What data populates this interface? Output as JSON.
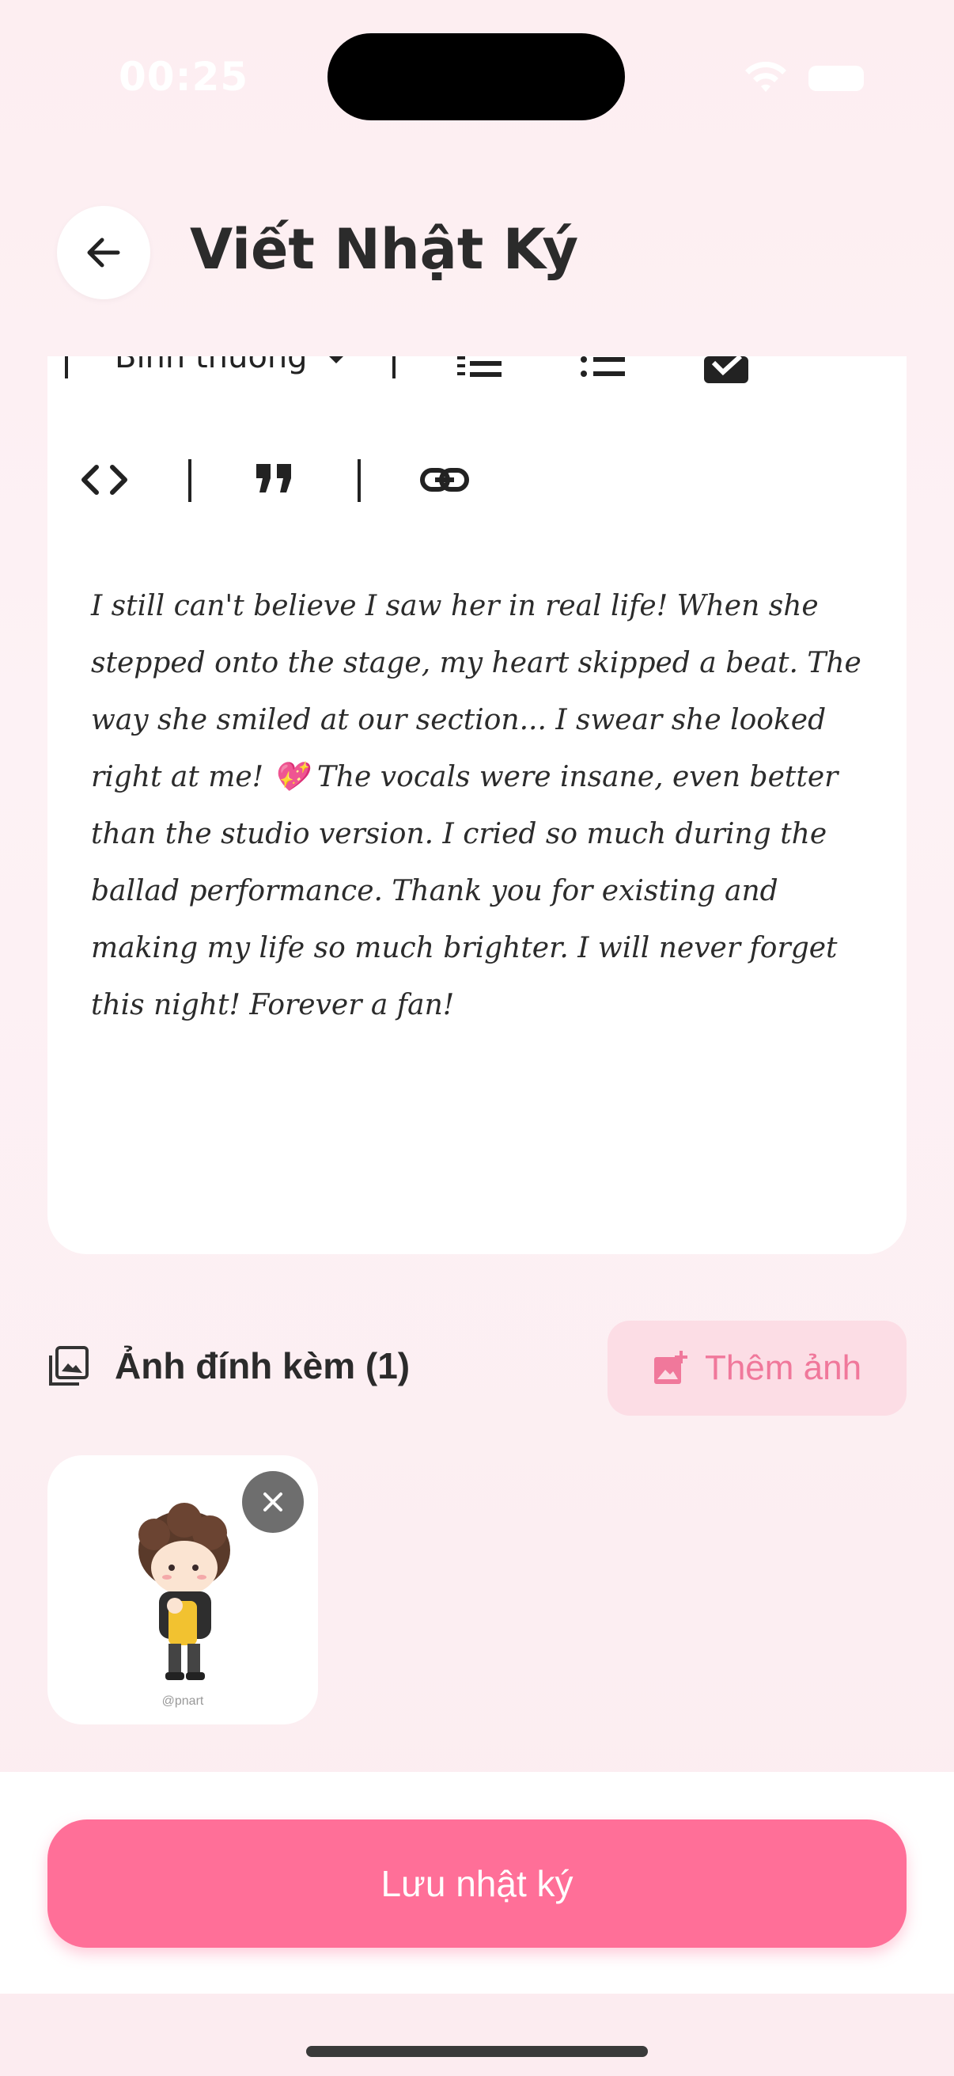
{
  "status_bar": {
    "time": "00:25"
  },
  "header": {
    "title": "Viết Nhật Ký",
    "back_icon": "arrow-left-icon"
  },
  "toolbar": {
    "text_style": "Bình thường",
    "icons": [
      "numbered-list-icon",
      "bulleted-list-icon",
      "checkbox-icon",
      "code-icon",
      "quote-icon",
      "link-icon"
    ]
  },
  "editor": {
    "content": "I still can't believe I saw her in real life! When she stepped onto the stage, my heart skipped a beat. The way she smiled at our section... I swear she looked right at me! 💖 The vocals were insane, even better than the studio version. I cried so much during the ballad performance. Thank you for existing and making my life so much brighter. I will never forget this night! Forever a fan!"
  },
  "attachments": {
    "label": "Ảnh đính kèm (1)",
    "add_button": "Thêm ảnh",
    "items": [
      {
        "watermark": "@pnart"
      }
    ]
  },
  "footer": {
    "save_button": "Lưu nhật ký"
  },
  "colors": {
    "accent": "#ff6f98",
    "accent_light": "#fcdde5",
    "accent_text": "#f0789b"
  }
}
